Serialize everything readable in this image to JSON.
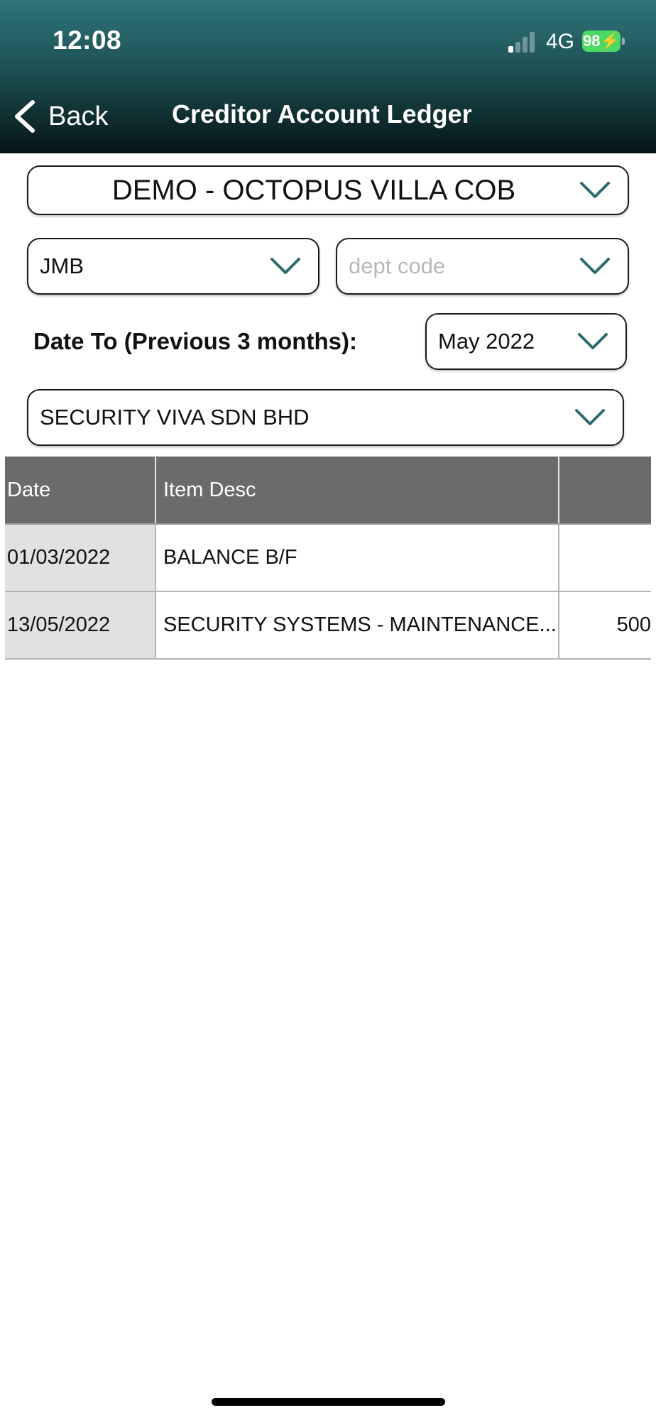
{
  "status_bar": {
    "time": "12:08",
    "network": "4G",
    "battery": "98"
  },
  "header": {
    "back_label": "Back",
    "title": "Creditor Account Ledger"
  },
  "filters": {
    "property": "DEMO - OCTOPUS VILLA COB",
    "organization": "JMB",
    "dept_code_placeholder": "dept code",
    "date_to_label": "Date To (Previous 3 months):",
    "date_to_value": "May 2022",
    "creditor": "SECURITY VIVA SDN BHD"
  },
  "table": {
    "headers": [
      "Date",
      "Item Desc",
      ""
    ],
    "rows": [
      {
        "date": "01/03/2022",
        "desc": "BALANCE B/F",
        "amount": ""
      },
      {
        "date": "13/05/2022",
        "desc": "SECURITY SYSTEMS - MAINTENANCE...",
        "amount": "500"
      }
    ]
  },
  "colors": {
    "header_top": "#2e7579",
    "header_bottom": "#061517",
    "chevron": "#2c6b6f",
    "table_header": "#6b6b6b",
    "battery": "#4cd964"
  },
  "icons": {
    "back": "chevron-left-icon",
    "dropdown": "chevron-down-icon"
  }
}
